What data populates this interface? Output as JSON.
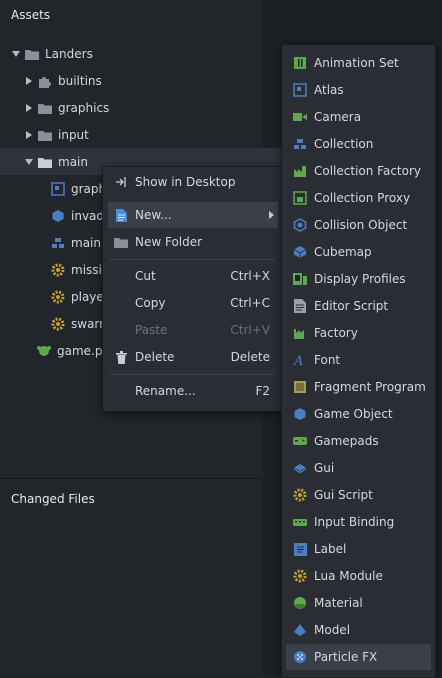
{
  "assets_panel": {
    "title": "Assets",
    "tree": [
      {
        "label": "Landers",
        "expanded": true,
        "icon": "folder-icon"
      },
      {
        "label": "builtins",
        "expanded": false,
        "icon": "puzzle-icon"
      },
      {
        "label": "graphics",
        "expanded": false,
        "icon": "folder-icon"
      },
      {
        "label": "input",
        "expanded": false,
        "icon": "folder-icon"
      },
      {
        "label": "main",
        "expanded": true,
        "icon": "folder-icon"
      },
      {
        "label": "graph",
        "icon": "atlas-icon"
      },
      {
        "label": "invado",
        "icon": "game-object-icon"
      },
      {
        "label": "main.",
        "icon": "collection-icon"
      },
      {
        "label": "missil",
        "icon": "script-gear-icon"
      },
      {
        "label": "player",
        "icon": "script-gear-icon"
      },
      {
        "label": "swarm",
        "icon": "script-gear-icon"
      },
      {
        "label": "game.pr",
        "icon": "project-icon"
      }
    ]
  },
  "changed_files_panel": {
    "title": "Changed Files"
  },
  "context_menu": {
    "items": [
      {
        "label": "Show in Desktop",
        "shortcut": "",
        "icon": "open-external-icon"
      },
      {
        "label": "New...",
        "shortcut": "",
        "icon": "new-file-icon",
        "highlighted": true,
        "has_submenu": true
      },
      {
        "label": "New Folder",
        "shortcut": "",
        "icon": "folder-icon"
      },
      {
        "label": "Cut",
        "shortcut": "Ctrl+X"
      },
      {
        "label": "Copy",
        "shortcut": "Ctrl+C"
      },
      {
        "label": "Paste",
        "shortcut": "Ctrl+V",
        "disabled": true
      },
      {
        "label": "Delete",
        "shortcut": "Delete",
        "icon": "trash-icon"
      },
      {
        "label": "Rename...",
        "shortcut": "F2"
      }
    ]
  },
  "new_submenu": {
    "items": [
      {
        "label": "Animation Set",
        "icon": "animation-set-icon"
      },
      {
        "label": "Atlas",
        "icon": "atlas-icon"
      },
      {
        "label": "Camera",
        "icon": "camera-icon"
      },
      {
        "label": "Collection",
        "icon": "collection-icon"
      },
      {
        "label": "Collection Factory",
        "icon": "collection-factory-icon"
      },
      {
        "label": "Collection Proxy",
        "icon": "collection-proxy-icon"
      },
      {
        "label": "Collision Object",
        "icon": "collision-object-icon"
      },
      {
        "label": "Cubemap",
        "icon": "cubemap-icon"
      },
      {
        "label": "Display Profiles",
        "icon": "display-profiles-icon"
      },
      {
        "label": "Editor Script",
        "icon": "editor-script-icon"
      },
      {
        "label": "Factory",
        "icon": "factory-icon"
      },
      {
        "label": "Font",
        "icon": "font-icon"
      },
      {
        "label": "Fragment Program",
        "icon": "fragment-program-icon"
      },
      {
        "label": "Game Object",
        "icon": "game-object-icon"
      },
      {
        "label": "Gamepads",
        "icon": "gamepads-icon"
      },
      {
        "label": "Gui",
        "icon": "gui-icon"
      },
      {
        "label": "Gui Script",
        "icon": "gui-script-icon"
      },
      {
        "label": "Input Binding",
        "icon": "input-binding-icon"
      },
      {
        "label": "Label",
        "icon": "label-icon"
      },
      {
        "label": "Lua Module",
        "icon": "lua-module-icon"
      },
      {
        "label": "Material",
        "icon": "material-icon"
      },
      {
        "label": "Model",
        "icon": "model-icon"
      },
      {
        "label": "Particle FX",
        "icon": "particle-fx-icon",
        "highlighted": true
      }
    ]
  },
  "colors": {
    "panel_bg": "#22262b",
    "menu_bg": "#2a2e34",
    "highlight_bg": "#3b4048",
    "text": "#d4d8de",
    "disabled_text": "#6b7079",
    "icon_green": "#5fa84f",
    "icon_blue": "#4a7fc1",
    "icon_yellow": "#c9a227"
  }
}
